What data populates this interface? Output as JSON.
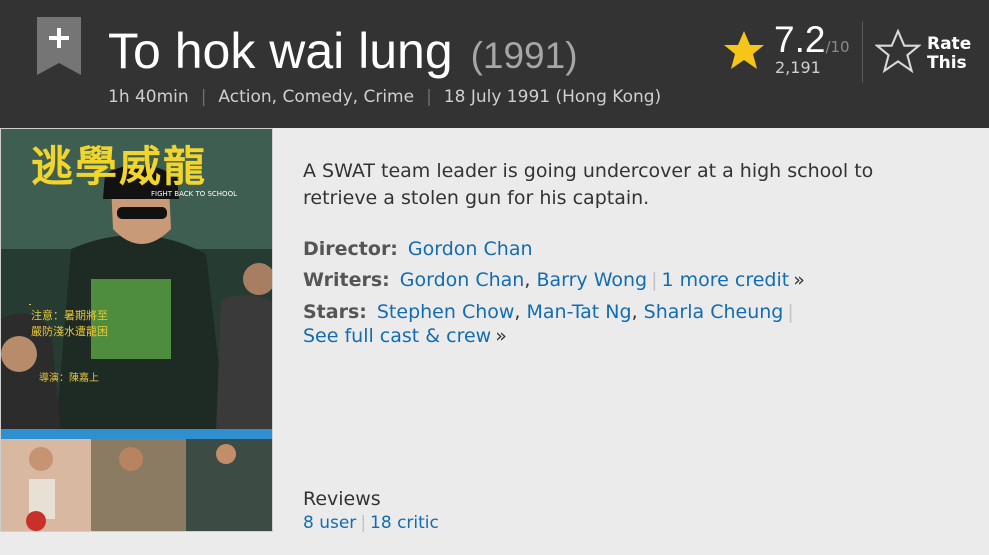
{
  "header": {
    "title": "To hok wai lung",
    "year": "(1991)",
    "runtime": "1h 40min",
    "genres": [
      {
        "label": "Action"
      },
      {
        "label": "Comedy"
      },
      {
        "label": "Crime"
      }
    ],
    "release_date": "18 July 1991 (Hong Kong)",
    "watchlist_icon": "plus-ribbon-icon"
  },
  "rating": {
    "value": "7.2",
    "best": "/10",
    "count": "2,191",
    "star_icon": "star-filled-icon",
    "star_color": "#f5c518"
  },
  "rate_this": {
    "label": "Rate This",
    "icon": "star-outline-icon"
  },
  "poster": {
    "chinese_title": "逃學威龍",
    "english_title": "FIGHT BACK TO SCHOOL"
  },
  "summary": "A SWAT team leader is going undercover at a high school to retrieve a stolen gun for his captain.",
  "credits": {
    "director_label": "Director:",
    "director": "Gordon Chan",
    "writers_label": "Writers:",
    "writers": [
      "Gordon Chan",
      "Barry Wong"
    ],
    "writers_more": "1 more credit",
    "stars_label": "Stars:",
    "stars": [
      "Stephen Chow",
      "Man-Tat Ng",
      "Sharla Cheung"
    ],
    "full_cast": "See full cast & crew",
    "more_symbol": "»"
  },
  "reviews": {
    "title": "Reviews",
    "user": "8 user",
    "critic": "18 critic"
  },
  "colors": {
    "header_bg": "#333333",
    "link": "#136cb2",
    "body_bg": "#ebebeb"
  }
}
